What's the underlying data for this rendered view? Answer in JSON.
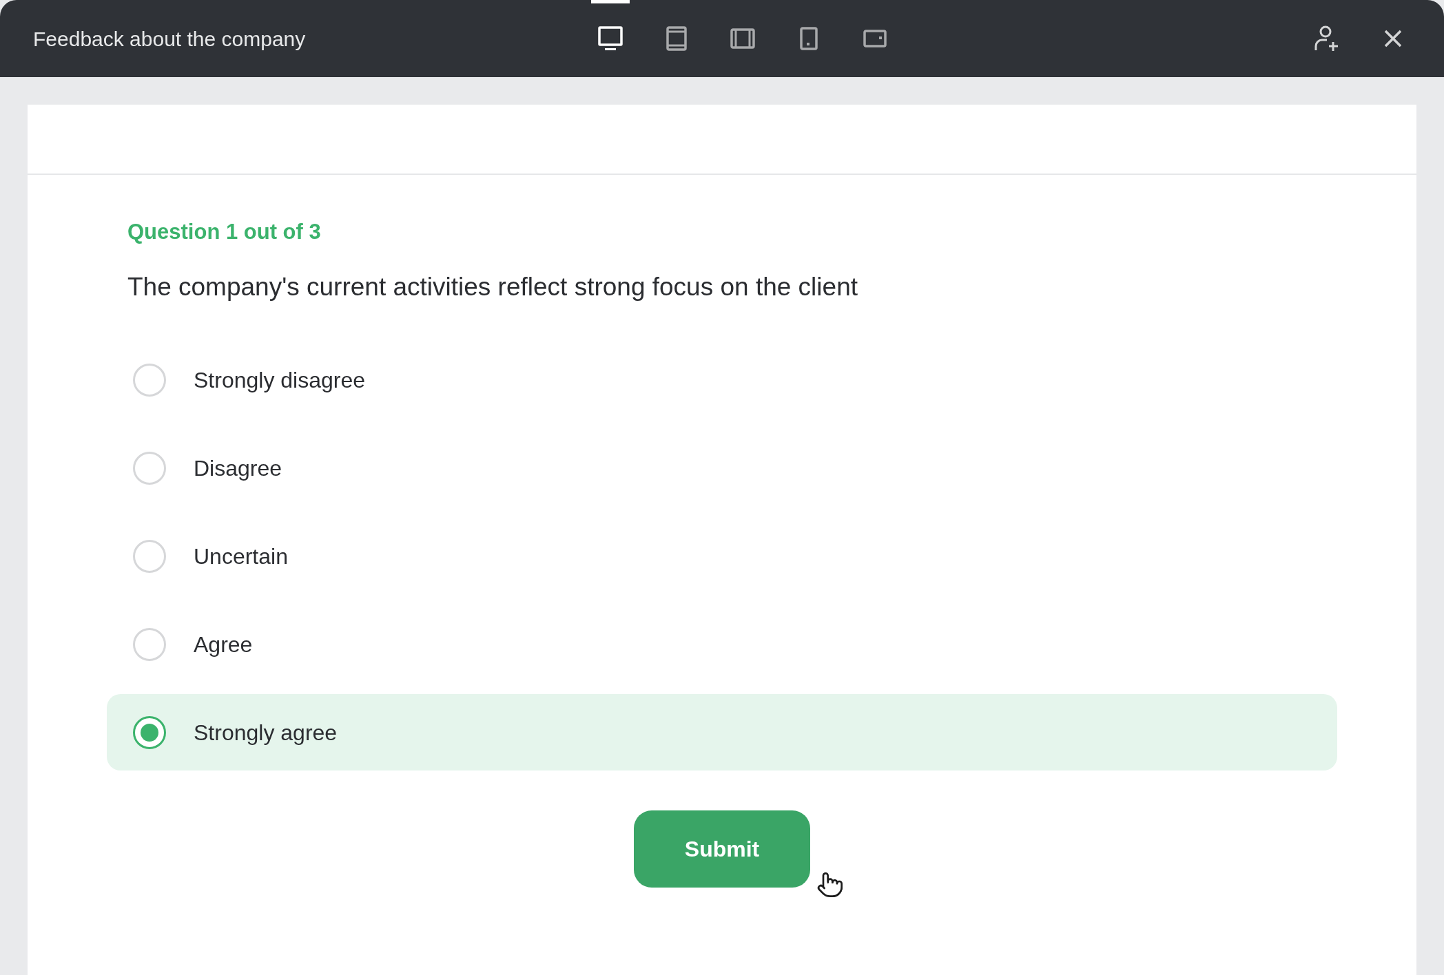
{
  "window": {
    "title": "Feedback about the company"
  },
  "device_tabs": [
    {
      "kind": "monitor",
      "selected": true
    },
    {
      "kind": "tablet",
      "selected": false
    },
    {
      "kind": "landscape",
      "selected": false
    },
    {
      "kind": "phone",
      "selected": false
    },
    {
      "kind": "phone_landscape",
      "selected": false
    }
  ],
  "question": {
    "counter": "Question 1 out of 3",
    "text": "The company's current activities reflect strong focus on the client"
  },
  "options": [
    {
      "label": "Strongly disagree",
      "selected": false
    },
    {
      "label": "Disagree",
      "selected": false
    },
    {
      "label": "Uncertain",
      "selected": false
    },
    {
      "label": "Agree",
      "selected": false
    },
    {
      "label": "Strongly agree",
      "selected": true
    }
  ],
  "submit": {
    "label": "Submit"
  }
}
